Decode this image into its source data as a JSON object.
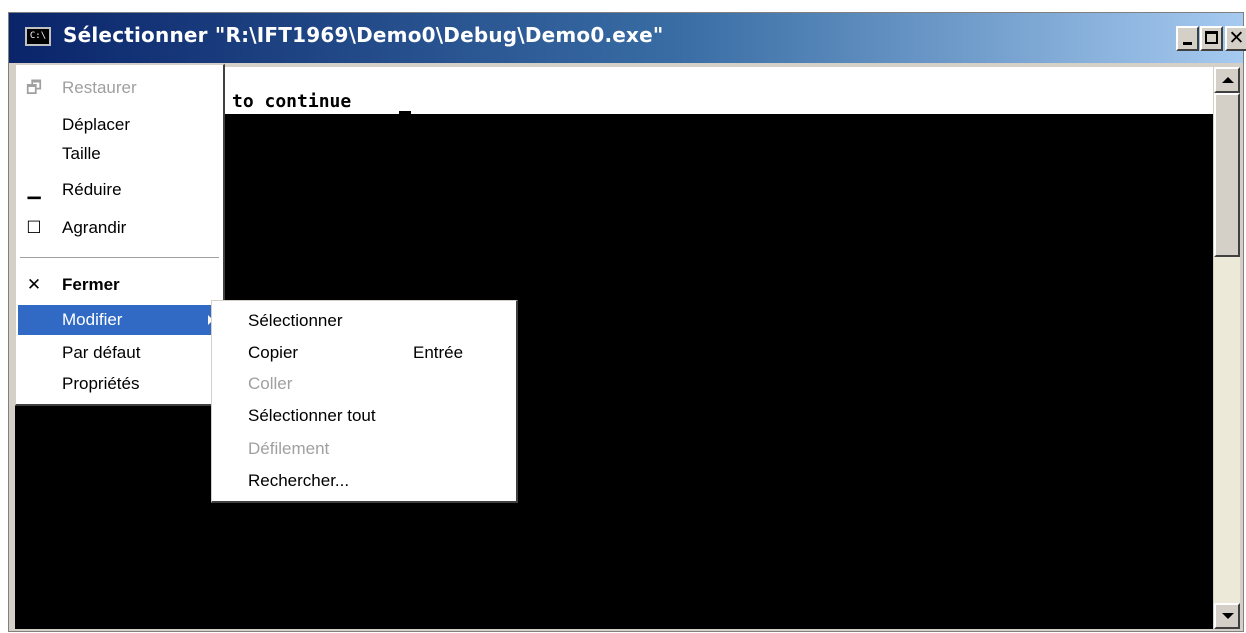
{
  "window": {
    "icon_label": "C:\\",
    "title": "Sélectionner \"R:\\IFT1969\\Demo0\\Debug\\Demo0.exe\"",
    "close_glyph": "✕"
  },
  "console": {
    "visible_text": "to continue"
  },
  "system_menu": {
    "items": [
      {
        "label": "Restaurer",
        "icon": "restore-icon",
        "glyph": "🗗",
        "disabled": true
      },
      {
        "label": "Déplacer"
      },
      {
        "label": "Taille"
      },
      {
        "label": "Réduire",
        "icon": "minimize-icon",
        "glyph": "▁"
      },
      {
        "label": "Agrandir",
        "icon": "maximize-icon",
        "glyph": "☐"
      },
      {
        "label": "Fermer",
        "icon": "close-icon",
        "glyph": "✕",
        "bold": true
      },
      {
        "label": "Modifier",
        "highlighted": true,
        "has_submenu": true
      },
      {
        "label": "Par défaut"
      },
      {
        "label": "Propriétés"
      }
    ]
  },
  "edit_submenu": {
    "items": [
      {
        "label": "Sélectionner"
      },
      {
        "label": "Copier",
        "shortcut": "Entrée"
      },
      {
        "label": "Coller",
        "disabled": true
      },
      {
        "label": "Sélectionner tout"
      },
      {
        "label": "Défilement",
        "disabled": true
      },
      {
        "label": "Rechercher..."
      }
    ]
  },
  "colors": {
    "titlebar_start": "#0a246a",
    "titlebar_end": "#a6caf0",
    "highlight": "#316ac5",
    "console_bg": "#000000"
  }
}
